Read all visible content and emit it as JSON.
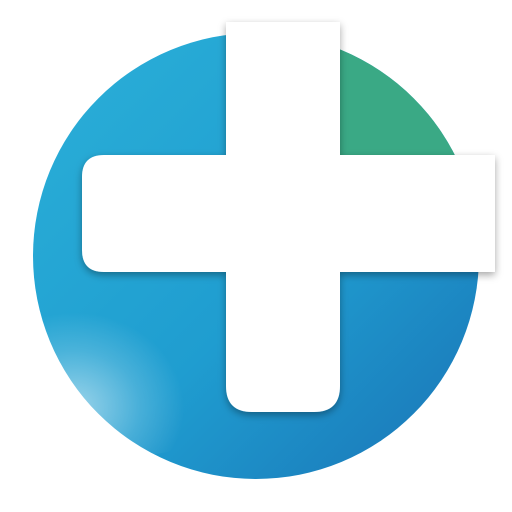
{
  "logo": {
    "icon_name": "medical-cross-logo",
    "colors": {
      "blue_light": "#2bb0d8",
      "blue_mid": "#1f9dd0",
      "blue_dark": "#1a73b6",
      "green": "#3aa985",
      "cross": "#ffffff",
      "background": "#ffffff"
    }
  }
}
